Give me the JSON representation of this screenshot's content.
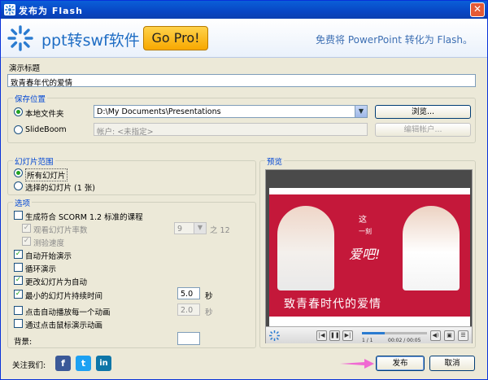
{
  "window": {
    "title": "发布为 Flash",
    "close_glyph": "✕"
  },
  "banner": {
    "brand": "ppt转swf软件",
    "gopro": "Go Pro!",
    "tagline": "免费将 PowerPoint 转化为 Flash。"
  },
  "title_section": {
    "label": "演示标题",
    "value": "致青春年代的爱情"
  },
  "save": {
    "legend": "保存位置",
    "local_label": "本地文件夹",
    "local_path": "D:\\My Documents\\Presentations",
    "browse": "浏览...",
    "slideboom_label": "SlideBoom",
    "account_placeholder": "帐户: <未指定>",
    "edit_account": "编辑帐户..."
  },
  "range": {
    "legend": "幻灯片范围",
    "all": "所有幻灯片",
    "selected": "选择的幻灯片 (1 张)"
  },
  "options": {
    "legend": "选项",
    "scorm": "生成符合 SCORM 1.2 标准的课程",
    "viewed_slides": "观看幻灯片率数",
    "viewed_value": "9",
    "viewed_suffix": "之 12",
    "quiz_speed": "测验速度",
    "autostart": "自动开始演示",
    "loop": "循环演示",
    "auto_advance": "更改幻灯片为自动",
    "min_duration": "最小的幻灯片持续时间",
    "min_value": "5.0",
    "sec1": "秒",
    "autoplay_anim": "点击自动播放每一个动画",
    "anim_value": "2.0",
    "sec2": "秒",
    "mouse_anim": "通过点击鼠标演示动画",
    "background": "背景:"
  },
  "preview": {
    "legend": "预览",
    "slide_title": "致青春时代的爱情",
    "slide_text_top": "这",
    "slide_text_mid": "一刻",
    "slide_text_love": "爱吧!",
    "page": "1 / 1",
    "time": "00:02 / 00:05",
    "progress": 0.35
  },
  "footer": {
    "follow": "关注我们:",
    "publish": "发布",
    "cancel": "取消"
  },
  "colors": {
    "facebook": "#3b5998",
    "twitter": "#1da1f2",
    "linkedin": "#0e76a8",
    "accent": "#0046d5"
  }
}
